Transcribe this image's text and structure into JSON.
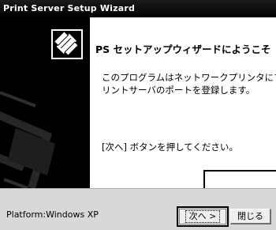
{
  "window": {
    "title": "Print Server Setup Wizard"
  },
  "content": {
    "heading": "PS セットアップウィザードにようこそ",
    "description": "このプログラムはネットワークプリンタにプ\nリントサーバのポートを登録します。",
    "instruction": "[次へ] ボタンを押してください。"
  },
  "footer": {
    "platform": "Platform:Windows XP",
    "next_label": "次へ >",
    "close_label": "閉じる"
  },
  "icons": {
    "wizard": "printer-wizard-icon"
  },
  "colors": {
    "titlebar": "#000000",
    "side_panel": "#000000",
    "bottom_bar": "#d8d8d8"
  }
}
